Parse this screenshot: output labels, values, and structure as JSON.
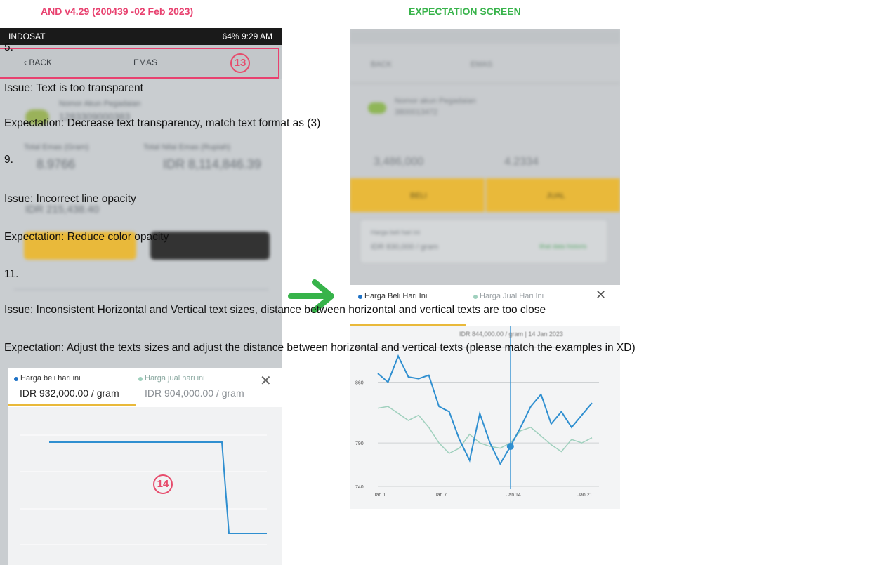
{
  "headings": {
    "left": "AND v4.29 (200439 -02 Feb 2023)",
    "right": "EXPECTATION SCREEN",
    "left_color": "#e8416f",
    "right_color": "#37b34a"
  },
  "left_screen": {
    "status_bar": {
      "carrier": "INDOSAT",
      "right": "64%  9:29 AM"
    },
    "nav": {
      "back_label": "BACK",
      "title": "EMAS",
      "badge": "13"
    },
    "account_label": "Nomor Akun Pegadaian",
    "account_number": "1283309000383",
    "gold_label": "Total Emas (Gram)",
    "gold_value": "8.9766",
    "value_label": "Total Nilai Emas (Rupiah)",
    "value_value": "IDR 8,114,846.39",
    "gain_value": "IDR 215,438.40",
    "price_buy_label": "Harga beli hari ini",
    "price_buy_value": "IDR 932,000.00 / gram",
    "price_sell_label": "Harga jual hari ini",
    "price_sell_value": "IDR 904,000.00 / gram",
    "close_icon": "close-icon",
    "chart_badge": "14"
  },
  "right_screen": {
    "back_label": "BACK",
    "title": "EMAS",
    "account_label": "Nomor akun Pegadaian",
    "account_number": "3800013472",
    "gold_value": "3,486,000",
    "gold_gram": "4.2334",
    "buy_button": "BELI",
    "sell_button": "JUAL",
    "price_label": "Harga beli hari ini",
    "price_value": "IDR 830,000 / gram",
    "price_link": "lihat data historis",
    "tab_buy": "Harga Beli Hari Ini",
    "tab_sell": "Harga Jual Hari Ini",
    "chart_tooltip": "IDR 844,000.00 / gram | 14 Jan 2023",
    "close_icon": "close-icon"
  },
  "notes": {
    "n5": "5.",
    "n5_issue": "Issue: Text is too transparent",
    "n5_expect": "Expectation: Decrease text transparency, match text format as (3)",
    "n9": "9.",
    "n9_issue": "Issue: Incorrect line opacity",
    "n9_expect": "Expectation: Reduce color opacity",
    "n11": "11.",
    "n11_issue": "Issue: Inconsistent Horizontal and Vertical text sizes, distance between horizontal and vertical texts are too close",
    "n11_expect": "Expectation: Adjust the texts sizes and adjust the distance between horizontal and vertical texts (please match the examples in XD)"
  },
  "colors": {
    "accent_red": "#e8416f",
    "accent_green": "#37b34a",
    "chart_blue": "#2f8fd0",
    "chart_green": "#9fd0bd",
    "gold": "#e9b93a"
  },
  "chart_data": [
    {
      "type": "line",
      "title": "",
      "xlabel": "",
      "ylabel": "",
      "x": [
        "Jan 1",
        "Jan 2",
        "Jan 3",
        "Jan 4",
        "Jan 5",
        "Jan 6",
        "Jan 7",
        "Jan 8",
        "Jan 9",
        "Jan 10",
        "Jan 11",
        "Jan 12",
        "Jan 13",
        "Jan 14",
        "Jan 15",
        "Jan 16",
        "Jan 17",
        "Jan 18",
        "Jan 19",
        "Jan 20",
        "Jan 21",
        "Jan 22"
      ],
      "x_tick_labels": [
        "Jan 1",
        "Jan 7",
        "Jan 14",
        "Jan 21"
      ],
      "y_tick_labels": [
        "900",
        "860",
        "790",
        "740"
      ],
      "ylim": [
        740,
        900
      ],
      "series": [
        {
          "name": "Harga Beli Hari Ini",
          "values": [
            870,
            860,
            890,
            866,
            864,
            868,
            832,
            826,
            794,
            770,
            824,
            790,
            766,
            786,
            808,
            832,
            846,
            812,
            826,
            808,
            822,
            836
          ]
        },
        {
          "name": "Harga Jual Hari Ini",
          "values": [
            830,
            832,
            824,
            816,
            822,
            808,
            790,
            778,
            784,
            800,
            790,
            786,
            784,
            790,
            804,
            808,
            798,
            788,
            780,
            794,
            790,
            796
          ]
        }
      ]
    },
    {
      "type": "line",
      "title": "",
      "xlabel": "",
      "ylabel": "",
      "series": [
        {
          "name": "Harga beli hari ini",
          "values": [
            932,
            932,
            932,
            932,
            932,
            932,
            904,
            904
          ]
        }
      ]
    }
  ]
}
